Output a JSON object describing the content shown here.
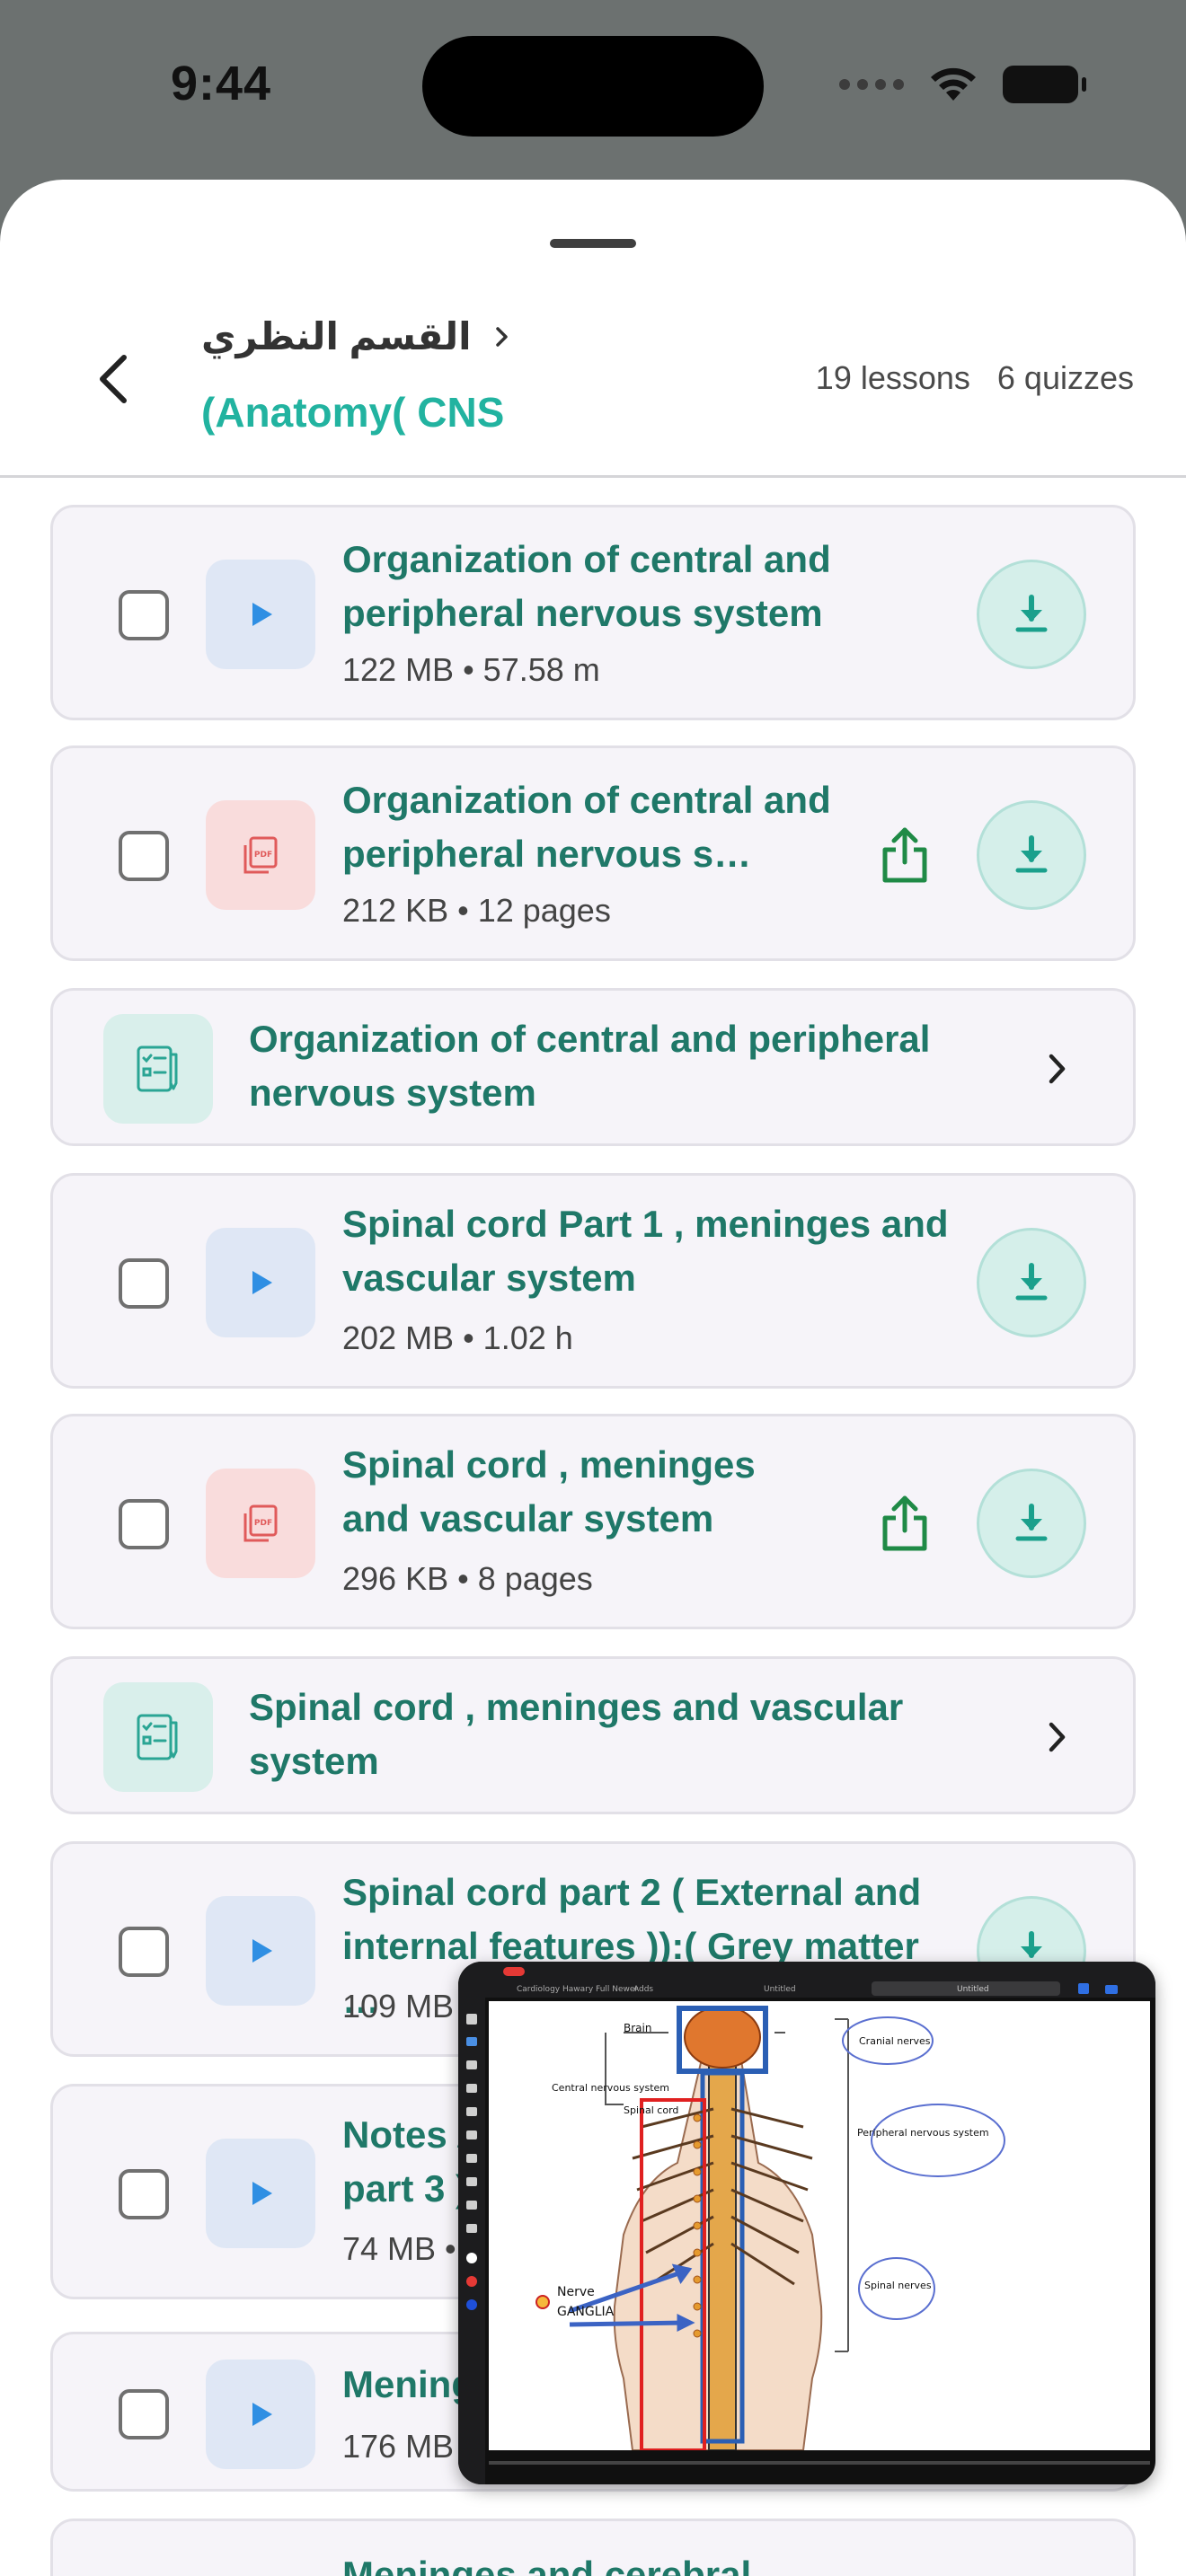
{
  "status": {
    "time": "9:44"
  },
  "header": {
    "breadcrumb": "القسم النظري",
    "title": "(Anatomy( CNS",
    "lessons_count": "19 lessons",
    "quizzes_count": "6 quizzes"
  },
  "items": [
    {
      "type": "video",
      "title": "Organization of central and peripheral nervous system",
      "meta": "122 MB • 57.58 m"
    },
    {
      "type": "pdf",
      "title": "Organization of central and peripheral nervous s…",
      "meta": "212 KB • 12 pages"
    },
    {
      "type": "quiz",
      "title": "Organization of central and peripheral nervous system"
    },
    {
      "type": "video",
      "title": "Spinal cord Part 1 , meninges and vascular system",
      "meta": "202 MB • 1.02 h"
    },
    {
      "type": "pdf",
      "title": "Spinal cord , meninges and vascular system",
      "meta": "296 KB • 8 pages"
    },
    {
      "type": "quiz",
      "title": "Spinal cord , meninges and vascular system"
    },
    {
      "type": "video",
      "title": "Spinal cord part 2 ( External and internal features )):( Grey matter …",
      "meta": "109 MB"
    },
    {
      "type": "video",
      "title": "Notes A part 3 )",
      "meta": "74 MB •"
    },
    {
      "type": "video",
      "title": "Mening",
      "meta": "176 MB"
    },
    {
      "type": "video",
      "title": "Meninges and cerebral"
    }
  ],
  "pip": {
    "labels": {
      "brain": "Brain",
      "cns": "Central nervous system",
      "spinal_cord": "Spinal cord",
      "cranial": "Cranial nerves",
      "pns": "Peripheral nervous system",
      "spinal_nerves": "Spinal nerves",
      "nerve": "Nerve",
      "ganglia": "GANGLIA"
    },
    "tab_title": "Cardiology Hawary Full Newer",
    "tab_adds": "Adds",
    "tab_untitled": "Untitled",
    "tab_untitled2": "Untitled"
  },
  "colors": {
    "accent_teal": "#22b3a0",
    "title_green": "#1f7868",
    "video_blue": "#2f8fe3",
    "pdf_red": "#e05a5a"
  }
}
